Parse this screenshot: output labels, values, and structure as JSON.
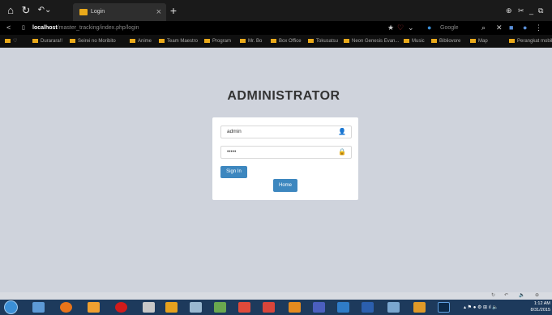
{
  "browser": {
    "tab_title": "Login",
    "tab_close": "×",
    "new_tab": "+",
    "address_host": "localhost",
    "address_path": "/master_tracking/index.php/login",
    "search_placeholder": "Google",
    "nav": {
      "home": "⌂",
      "reload": "C",
      "back": "<"
    }
  },
  "bookmarks": [
    "Durarara!!",
    "Seirei no Moribito",
    "Anime",
    "Team Maestro",
    "Program",
    "Mr. Bo",
    "Box Office",
    "Tokusatsu",
    "Neon Genesis Evan...",
    "Music",
    "Bibliovore",
    "Map",
    "Perangkat mobil"
  ],
  "login": {
    "title": "ADMINISTRATOR",
    "username_value": "admin",
    "password_value": "•••••",
    "signin_label": "Sign In",
    "home_label": "Home"
  },
  "taskbar": {
    "time": "1:12 AM",
    "date": "8/31/2015"
  },
  "colors": {
    "accent": "#3d87bf",
    "page_bg": "#cfd3dc",
    "taskbar": "#1d3a5c"
  }
}
